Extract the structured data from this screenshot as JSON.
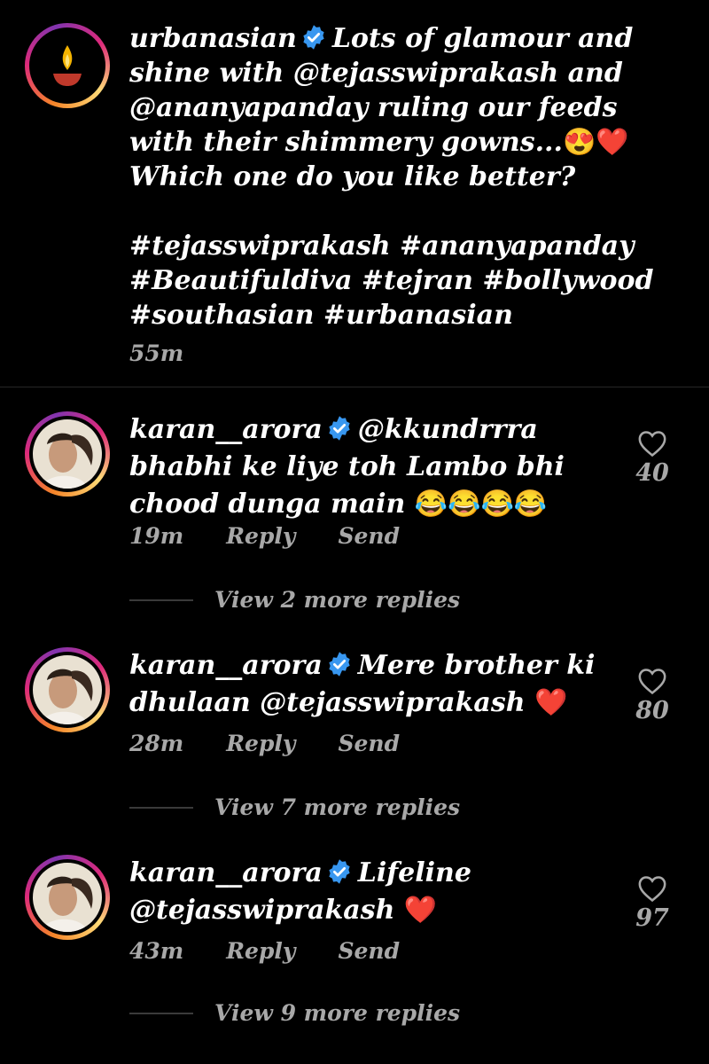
{
  "post": {
    "username": "urbanasian",
    "caption": "Lots of glamour and shine with @tejasswiprakash and @ananyapanday ruling our feeds with their shimmery gowns...",
    "caption_emojis": "😍❤️",
    "question": "Which one do you like better?",
    "hashtags": "#tejasswiprakash #ananyapanday #Beautifuldiva #tejran #bollywood #southasian #urbanasian",
    "time": "55m"
  },
  "comments": [
    {
      "username": "karan__arora",
      "text": "@kkundrrra bhabhi ke liye toh Lambo bhi chood dunga main",
      "emojis": "😂😂😂😂",
      "time": "19m",
      "reply_label": "Reply",
      "send_label": "Send",
      "likes": "40",
      "view_replies": "View 2 more replies"
    },
    {
      "username": "karan__arora",
      "text": "Mere brother ki dhulaan @tejasswiprakash",
      "emojis": "❤️",
      "time": "28m",
      "reply_label": "Reply",
      "send_label": "Send",
      "likes": "80",
      "view_replies": "View 7 more replies"
    },
    {
      "username": "karan__arora",
      "text": "Lifeline @tejasswiprakash",
      "emojis": "❤️",
      "time": "43m",
      "reply_label": "Reply",
      "send_label": "Send",
      "likes": "97",
      "view_replies": "View 9 more replies"
    }
  ],
  "icons": {
    "verified": "verified-badge-icon",
    "like": "heart-icon",
    "post_avatar": "diya-lamp-icon"
  },
  "colors": {
    "background": "#000000",
    "text": "#ffffff",
    "muted": "#a8a8a8",
    "verified": "#3897f0"
  }
}
